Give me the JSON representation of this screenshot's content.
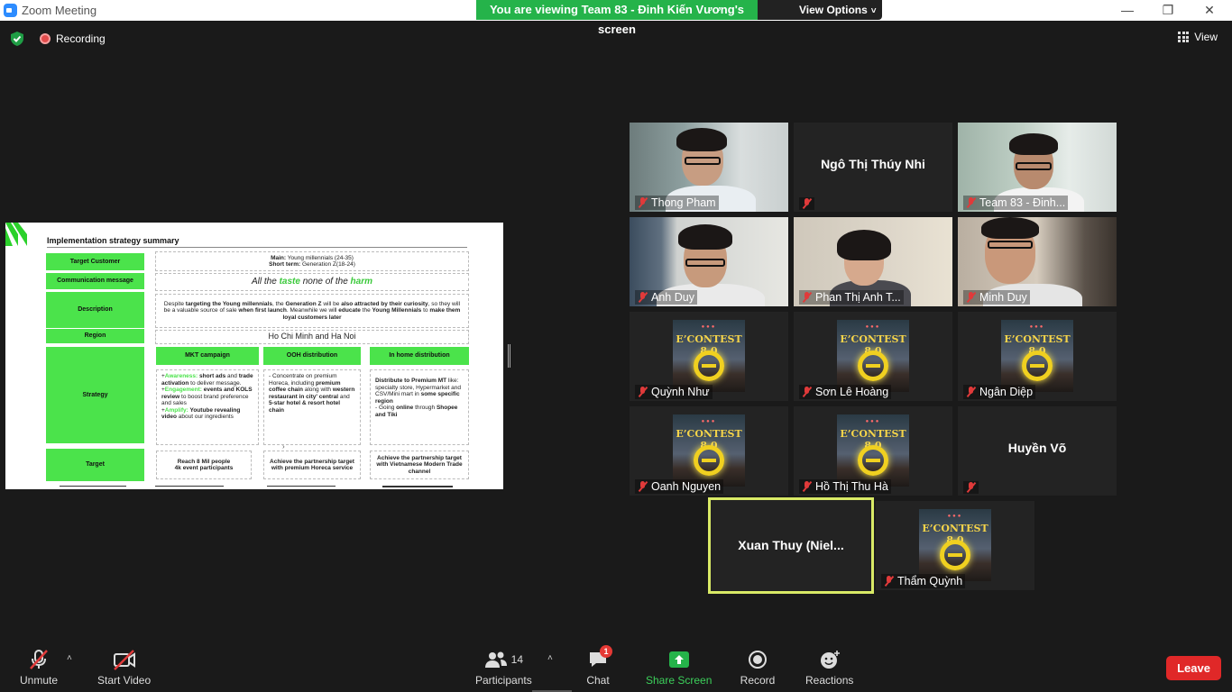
{
  "window": {
    "title": "Zoom Meeting",
    "minimize": "—",
    "maximize": "❐",
    "close": "✕"
  },
  "banner": {
    "viewing": "You are viewing Team 83 - Đinh Kiến Vương's screen",
    "view_options": "View Options",
    "chev": "˅"
  },
  "top": {
    "recording": "Recording",
    "view": "View"
  },
  "slide": {
    "title": "Implementation strategy summary",
    "labels": {
      "target_customer": "Target Customer",
      "communication": "Communication message",
      "description": "Description",
      "region": "Region",
      "strategy": "Strategy",
      "target": "Target"
    },
    "target_customer": {
      "main_k": "Main:",
      "main_v": " Young millennials (24-35)",
      "short_k": "Short term:",
      "short_v": " Generation Z(18-24)"
    },
    "tagline": {
      "a": "All the ",
      "b": "taste",
      "c": " none of the ",
      "d": "harm"
    },
    "description": {
      "p1": "Despite ",
      "p2": "targeting the Young millennials",
      "p3": ", the ",
      "p4": "Generation Z",
      "p5": " will be ",
      "p6": "also attracted by their curiosity",
      "p7": ", so they will be a valuable source of sale ",
      "p8": "when first launch",
      "p9": ". Meanwhile we will ",
      "p10": "educate",
      "p11": " the ",
      "p12": "Young Millennials",
      "p13": " to ",
      "p14": "make them loyal customers later"
    },
    "region": "Ho Chi Minh and Ha Noi",
    "columns": [
      "MKT campaign",
      "OOH distribution",
      "In home distribution"
    ],
    "mkt": {
      "l1a": "+",
      "l1b": "Awareness:",
      "l1c": " short ads",
      "l1d": " and ",
      "l1e": "trade activation",
      "l1f": " to deliver message.",
      "l2a": "+",
      "l2b": "Engagement:",
      "l2c": " events and KOLS review",
      "l2d": " to  boost brand preference and sales",
      "l3a": "+",
      "l3b": "Amplify:",
      "l3c": " Youtube revealing video",
      "l3d": " about our ingredients"
    },
    "ooh": {
      "a": "- Concentrate on premium Horeca, including ",
      "b": "premium coffee chain",
      "c": " along with ",
      "d": "western restaurant in city' central",
      "e": " and ",
      "f": "5-star hotel & resort hotel chain"
    },
    "inhome": {
      "a": "Distribute to Premium MT",
      "b": " like: specialty store, Hypermarket and CSV/Mini mart in ",
      "c": "some specific region",
      "d": "- Going ",
      "e": "online",
      "f": " through ",
      "g": "Shopee and Tiki"
    },
    "targets": [
      "Reach 8 Mil people\n4k event participants",
      "Achieve the partnership target with premium Horeca service",
      "Achieve the partnership target with Vietnamese Modern Trade channel"
    ],
    "mkt_bullet": "›"
  },
  "econtest_title": "E’CONTEST 8.0",
  "econtest_dots": "●●●",
  "participants": [
    "Thong Pham",
    "Ngô Thị Thúy Nhi",
    "Team 83 - Đinh...",
    "Anh Duy",
    "Phan Thị Anh T...",
    "Minh Duy",
    "Quỳnh Như",
    "Sơn Lê Hoàng",
    "Ngân Diệp",
    "Oanh Nguyen",
    "Hồ Thị Thu Hà",
    "Huyền Võ",
    "Xuan Thuy (Niel...",
    "Thẩm Quỳnh"
  ],
  "toolbar": {
    "unmute": "Unmute",
    "start_video": "Start Video",
    "participants": "Participants",
    "participants_count": "14",
    "chat": "Chat",
    "chat_badge": "1",
    "share": "Share Screen",
    "record": "Record",
    "reactions": "Reactions",
    "leave": "Leave",
    "caret": "˄"
  },
  "colors": {
    "accent_green": "#25b34a",
    "slide_green": "#4be34b",
    "leave_red": "#e02828",
    "active_border": "#d9ea66"
  }
}
